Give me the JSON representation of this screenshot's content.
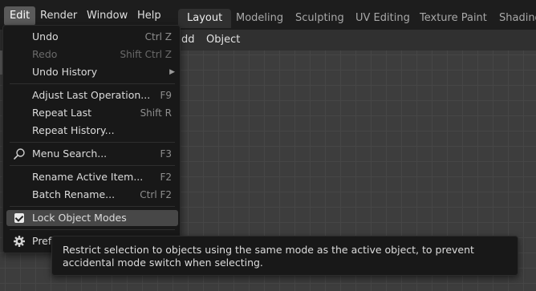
{
  "topbar": {
    "menus": [
      "Edit",
      "Render",
      "Window",
      "Help"
    ],
    "workspaces": [
      "Layout",
      "Modeling",
      "Sculpting",
      "UV Editing",
      "Texture Paint",
      "Shading"
    ]
  },
  "viewport_header": {
    "add_partial": "dd",
    "object": "Object"
  },
  "edit_menu": {
    "undo": {
      "label": "Undo",
      "shortcut": "Ctrl Z"
    },
    "redo": {
      "label": "Redo",
      "shortcut": "Shift Ctrl Z"
    },
    "undo_history": {
      "label": "Undo History"
    },
    "adjust_last": {
      "label": "Adjust Last Operation...",
      "shortcut": "F9"
    },
    "repeat_last": {
      "label": "Repeat Last",
      "shortcut": "Shift R"
    },
    "repeat_history": {
      "label": "Repeat History..."
    },
    "menu_search": {
      "label": "Menu Search...",
      "shortcut": "F3"
    },
    "rename_active": {
      "label": "Rename Active Item...",
      "shortcut": "F2"
    },
    "batch_rename": {
      "label": "Batch Rename...",
      "shortcut": "Ctrl F2"
    },
    "lock_object_modes": {
      "label": "Lock Object Modes",
      "checked": true
    },
    "preferences": {
      "label": "Prefe"
    }
  },
  "tooltip": {
    "text": "Restrict selection to objects using the same mode as the active object, to prevent accidental mode switch when selecting."
  },
  "colors": {
    "background": "#1d1d1d",
    "menu_bg": "#181818",
    "active_tab": "#303030",
    "viewport": "#3d3d3d",
    "hover": "#474747"
  }
}
